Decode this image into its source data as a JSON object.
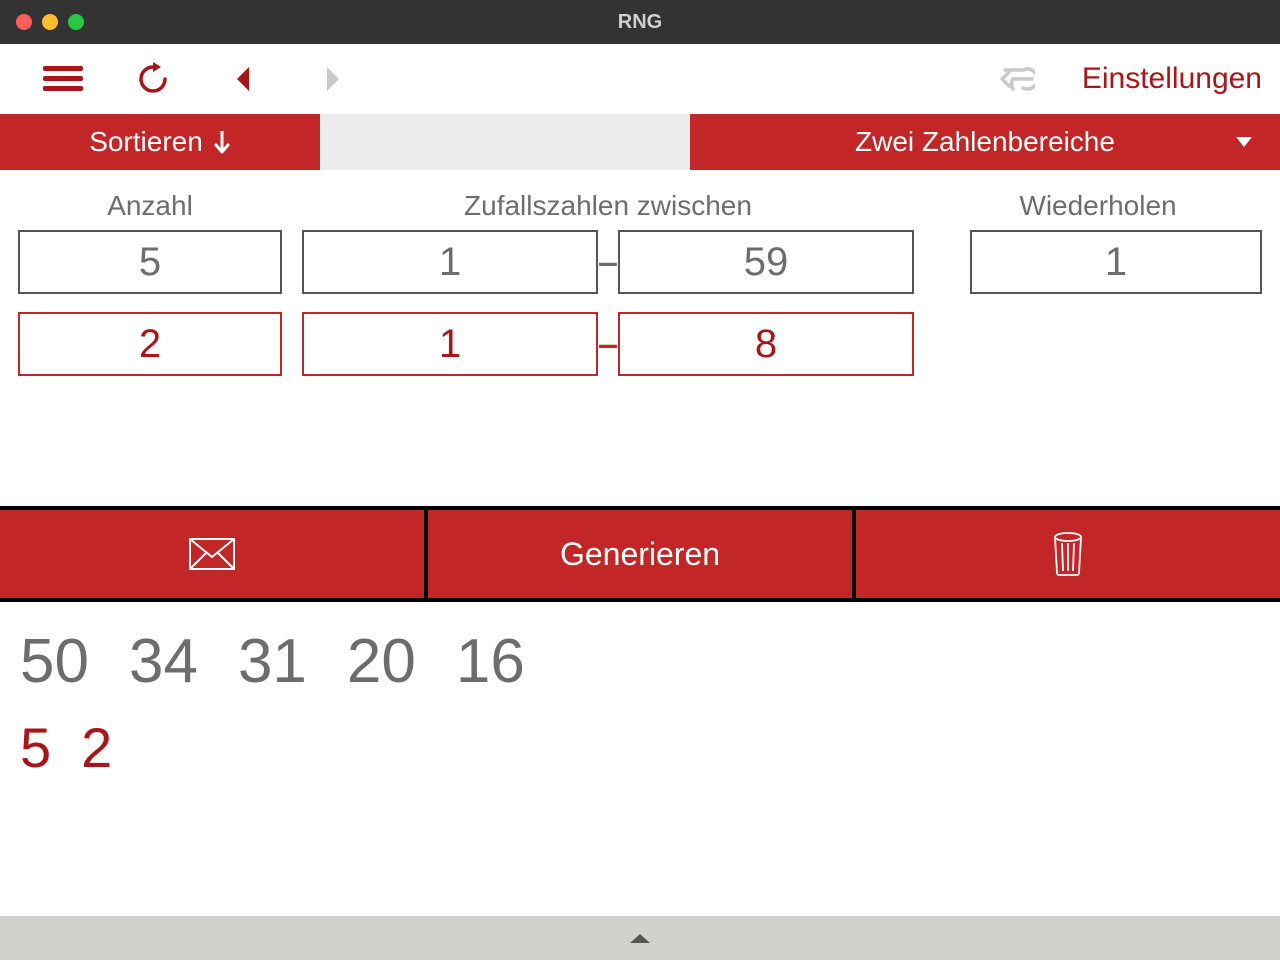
{
  "window": {
    "title": "RNG"
  },
  "toolbar": {
    "settings": "Einstellungen"
  },
  "subbar": {
    "sort_label": "Sortieren",
    "mode_label": "Zwei Zahlenbereiche"
  },
  "labels": {
    "count": "Anzahl",
    "range": "Zufallszahlen zwischen",
    "repeat": "Wiederholen"
  },
  "range1": {
    "count": "5",
    "min": "1",
    "max": "59",
    "repeat": "1"
  },
  "range2": {
    "count": "2",
    "min": "1",
    "max": "8"
  },
  "actions": {
    "generate": "Generieren"
  },
  "results": {
    "primary": [
      "50",
      "34",
      "31",
      "20",
      "16"
    ],
    "secondary": [
      "5",
      "2"
    ]
  }
}
